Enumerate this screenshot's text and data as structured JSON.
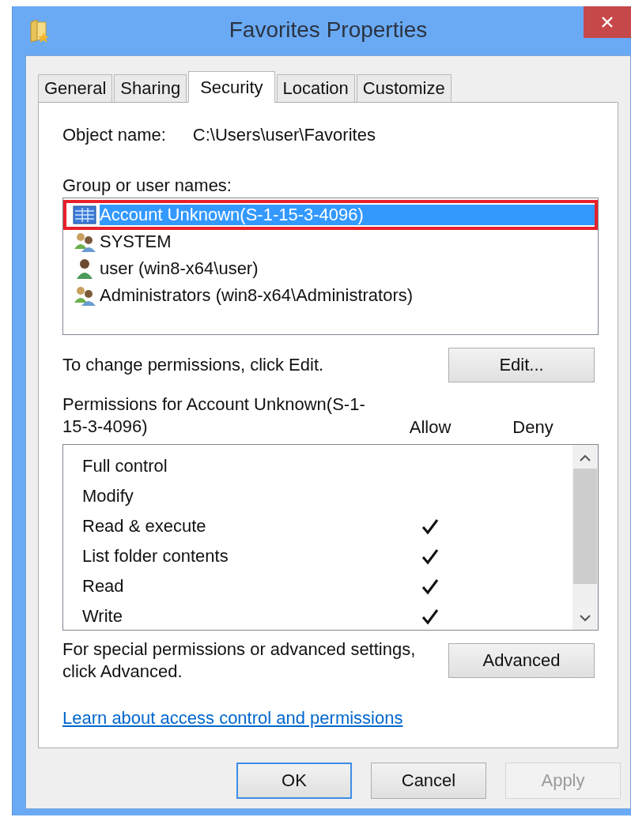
{
  "window": {
    "title": "Favorites Properties"
  },
  "tabs": [
    {
      "label": "General",
      "selected": false
    },
    {
      "label": "Sharing",
      "selected": false
    },
    {
      "label": "Security",
      "selected": true
    },
    {
      "label": "Location",
      "selected": false
    },
    {
      "label": "Customize",
      "selected": false
    }
  ],
  "object_name": {
    "label": "Object name:",
    "value": "C:\\Users\\user\\Favorites"
  },
  "group_list": {
    "label": "Group or user names:",
    "items": [
      {
        "kind": "account",
        "name": "Account Unknown(S-1-15-3-4096)",
        "selected": true,
        "outlined": true
      },
      {
        "kind": "group",
        "name": "SYSTEM",
        "selected": false,
        "outlined": false
      },
      {
        "kind": "user",
        "name": "user (win8-x64\\user)",
        "selected": false,
        "outlined": false
      },
      {
        "kind": "group",
        "name": "Administrators (win8-x64\\Administrators)",
        "selected": false,
        "outlined": false
      }
    ]
  },
  "edit_hint": "To change permissions, click Edit.",
  "edit_button": "Edit...",
  "permissions": {
    "label": "Permissions for Account Unknown(S-1-15-3-4096)",
    "columns": [
      "Allow",
      "Deny"
    ],
    "rows": [
      {
        "name": "Full control",
        "allow": false,
        "deny": false
      },
      {
        "name": "Modify",
        "allow": false,
        "deny": false
      },
      {
        "name": "Read & execute",
        "allow": true,
        "deny": false
      },
      {
        "name": "List folder contents",
        "allow": true,
        "deny": false
      },
      {
        "name": "Read",
        "allow": true,
        "deny": false
      },
      {
        "name": "Write",
        "allow": true,
        "deny": false
      }
    ]
  },
  "advanced_hint": "For special permissions or advanced settings, click Advanced.",
  "advanced_button": "Advanced",
  "link": "Learn about access control and permissions",
  "buttons": [
    {
      "label": "OK",
      "default": true,
      "disabled": false
    },
    {
      "label": "Cancel",
      "default": false,
      "disabled": false
    },
    {
      "label": "Apply",
      "default": false,
      "disabled": true
    }
  ]
}
